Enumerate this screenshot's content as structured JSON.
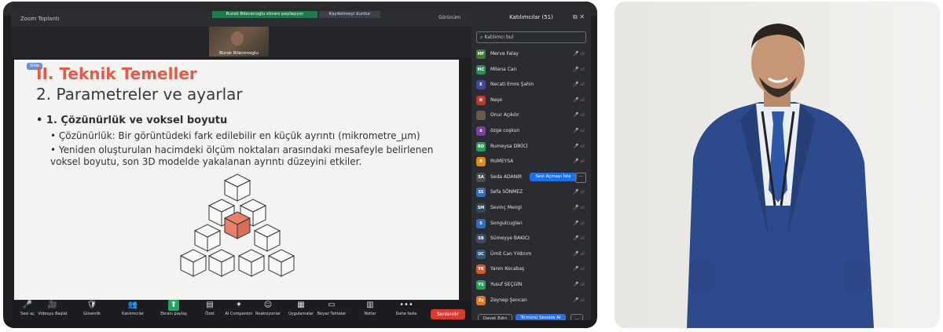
{
  "zoom": {
    "window_title": "Zoom Toplantı",
    "banner_text": "Burak Bilecenoglu ekranı paylaşıyor",
    "recording_text": "Kaydetmeyi durdur",
    "view_label": "Görünüm",
    "speaker_name": "Burak Bilecenoglu"
  },
  "slide": {
    "tag": "Slide",
    "title1": "II. Teknik Temeller",
    "title2": "2. Parametreler ve ayarlar",
    "bullet1": "• 1. Çözünürlük ve voksel boyutu",
    "bullet2": "• Çözünürlük: Bir görüntüdeki fark edilebilir en küçük ayrıntı (mikrometre_μm)",
    "bullet3": "• Yeniden oluşturulan hacimdeki ölçüm noktaları arasındaki mesafeyle belirlenen voksel boyutu, son 3D modelde yakalanan ayrıntı düzeyini etkiler.",
    "highlight_color": "#e8806a"
  },
  "toolbar": {
    "items": [
      {
        "icon": "🎤",
        "label": "Sesi aç"
      },
      {
        "icon": "🎥",
        "label": "Videoyu Başlat"
      },
      {
        "icon": "🛡",
        "label": "Güvenlik"
      },
      {
        "icon": "👥",
        "label": "Katılımcılar"
      },
      {
        "icon": "⬆",
        "label": "Ekranı paylaş"
      },
      {
        "icon": "▤",
        "label": "Özet"
      },
      {
        "icon": "✦",
        "label": "AI Companion"
      },
      {
        "icon": "☺",
        "label": "Reaksiyonlar"
      },
      {
        "icon": "▦",
        "label": "Uygulamalar"
      },
      {
        "icon": "▭",
        "label": "Beyaz Tahtalar"
      },
      {
        "icon": "▥",
        "label": "Notlar"
      },
      {
        "icon": "•••",
        "label": "Daha fazla"
      }
    ],
    "end_label": "Sonlandır"
  },
  "participants": {
    "header": "Katılımcılar (51)",
    "search_placeholder": "Katılımcı bul",
    "unmute_label": "Sesi Açmayı İste",
    "invite_label": "Davet Edin",
    "mute_all_label": "Tümünü Sessize Al",
    "more_label": "...",
    "list": [
      {
        "initials": "MF",
        "name": "Merve Falay",
        "color": "#3f7a3a"
      },
      {
        "initials": "MC",
        "name": "Milena Can",
        "color": "#2f8f5a"
      },
      {
        "initials": "E",
        "name": "Necati Emre Şahin",
        "color": "#3b4a9a"
      },
      {
        "initials": "N",
        "name": "Neşe",
        "color": "#c0392b"
      },
      {
        "initials": "",
        "name": "Onur Açıkılır",
        "color": "#6a5a4a"
      },
      {
        "initials": "ö",
        "name": "özge coşkun",
        "color": "#7b3fa0"
      },
      {
        "initials": "RD",
        "name": "Rumeysa DİKİCİ",
        "color": "#27a05a"
      },
      {
        "initials": "R",
        "name": "RUMEYSA",
        "color": "#e08a1c"
      },
      {
        "initials": "SA",
        "name": "Seda ADANIR",
        "color": "#4a4d55"
      },
      {
        "initials": "SS",
        "name": "Sefa SÖNMEZ",
        "color": "#2f6fc0"
      },
      {
        "initials": "SM",
        "name": "Sevinç Mengi",
        "color": "#2f4a58"
      },
      {
        "initials": "S",
        "name": "Songulcuglan",
        "color": "#2f6fc0"
      },
      {
        "initials": "SB",
        "name": "Sümeyye BAKICI",
        "color": "#3d4a6a"
      },
      {
        "initials": "UC",
        "name": "Ümit Can Yıldırım",
        "color": "#2f5a7a"
      },
      {
        "initials": "YK",
        "name": "Yaren Kocabaş",
        "color": "#d25a2a"
      },
      {
        "initials": "YS",
        "name": "Yusuf SEÇGİN",
        "color": "#2aa05a"
      },
      {
        "initials": "Zş",
        "name": "Zeynep Şencan",
        "color": "#e07a2a"
      }
    ]
  }
}
